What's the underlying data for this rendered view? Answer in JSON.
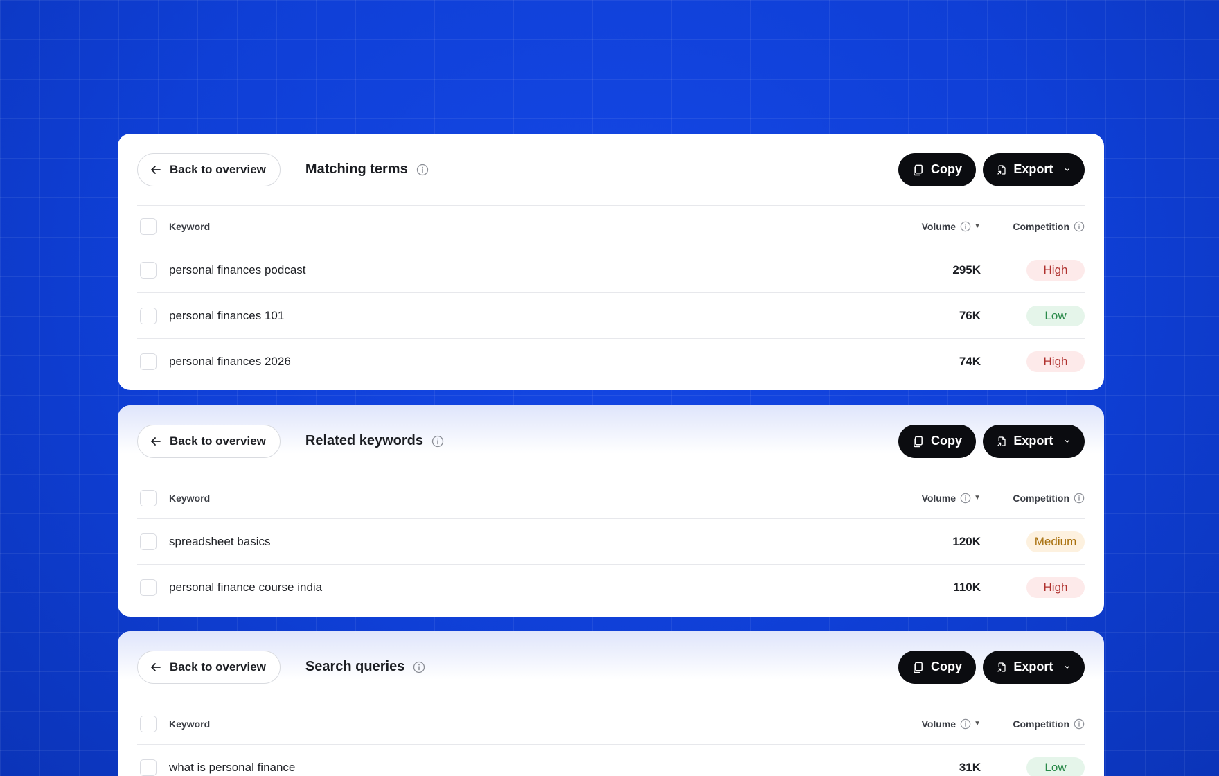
{
  "sections": [
    {
      "back_label": "Back to overview",
      "title": "Matching terms",
      "copy_label": "Copy",
      "export_label": "Export",
      "columns": {
        "keyword": "Keyword",
        "volume": "Volume",
        "competition": "Competition"
      },
      "rows": [
        {
          "keyword": "personal finances podcast",
          "volume": "295K",
          "competition": "High"
        },
        {
          "keyword": "personal finances 101",
          "volume": "76K",
          "competition": "Low"
        },
        {
          "keyword": "personal finances 2026",
          "volume": "74K",
          "competition": "High"
        }
      ]
    },
    {
      "back_label": "Back to overview",
      "title": "Related keywords",
      "copy_label": "Copy",
      "export_label": "Export",
      "columns": {
        "keyword": "Keyword",
        "volume": "Volume",
        "competition": "Competition"
      },
      "rows": [
        {
          "keyword": "spreadsheet basics",
          "volume": "120K",
          "competition": "Medium"
        },
        {
          "keyword": "personal finance course india",
          "volume": "110K",
          "competition": "High"
        }
      ]
    },
    {
      "back_label": "Back to overview",
      "title": "Search queries",
      "copy_label": "Copy",
      "export_label": "Export",
      "columns": {
        "keyword": "Keyword",
        "volume": "Volume",
        "competition": "Competition"
      },
      "rows": [
        {
          "keyword": "what is personal finance",
          "volume": "31K",
          "competition": "Low"
        }
      ]
    }
  ],
  "colors": {
    "background": "#0f3fd6",
    "button_dark": "#0b0c10",
    "high_bg": "#fdeaea",
    "high_text": "#b0322f",
    "low_bg": "#e5f5ea",
    "low_text": "#2a8a4a",
    "medium_bg": "#fdf1df",
    "medium_text": "#a8700d"
  },
  "icons": {
    "back": "arrow-left-icon",
    "info": "info-circle-icon",
    "copy": "copy-icon",
    "export": "export-file-icon",
    "dropdown": "chevron-down-icon",
    "sort": "sort-caret-down-icon"
  }
}
